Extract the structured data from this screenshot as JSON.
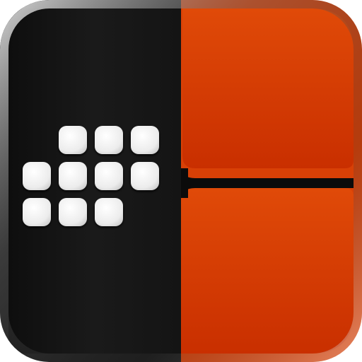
{
  "app_icon": {
    "icon": "dot-grid-split-panel-icon",
    "dot_rows": [
      [
        false,
        true,
        true,
        true
      ],
      [
        true,
        true,
        true,
        true
      ],
      [
        true,
        true,
        true,
        false
      ]
    ]
  },
  "colors": {
    "frame_dark": "#1a1a1a",
    "left_panel": "#151515",
    "right_panel_top": "#e04a08",
    "right_panel_bottom": "#c92f00",
    "divider": "#0c0c0c",
    "dot": "#ececec",
    "bevel_highlight": "#bdbdbd"
  }
}
